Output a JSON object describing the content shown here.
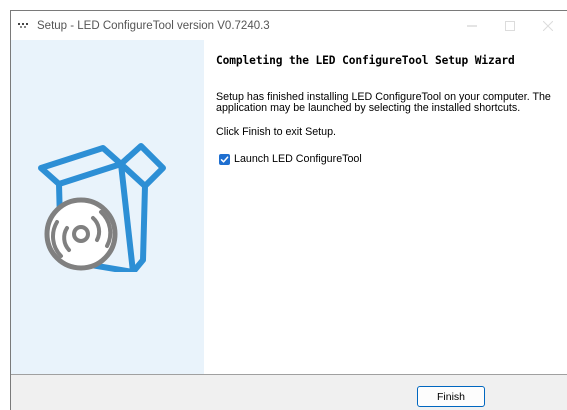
{
  "window": {
    "title": "Setup - LED ConfigureTool version V0.7240.3"
  },
  "content": {
    "heading": "Completing the LED ConfigureTool Setup Wizard",
    "body_text": "Setup has finished installing LED ConfigureTool on your computer. The application may be launched by selecting the installed shortcuts.",
    "exit_text": "Click Finish to exit Setup.",
    "launch_checkbox": {
      "label": "Launch LED ConfigureTool",
      "checked": true
    }
  },
  "footer": {
    "finish_label": "Finish"
  },
  "colors": {
    "sidebar_bg": "#e9f3fb",
    "box_blue": "#2d8fd5",
    "checkbox_blue": "#1f6fd0",
    "button_border": "#0067c0"
  },
  "icons": {
    "app_icon": "installer-icon",
    "sidebar_art": "box-with-disc-icon"
  }
}
